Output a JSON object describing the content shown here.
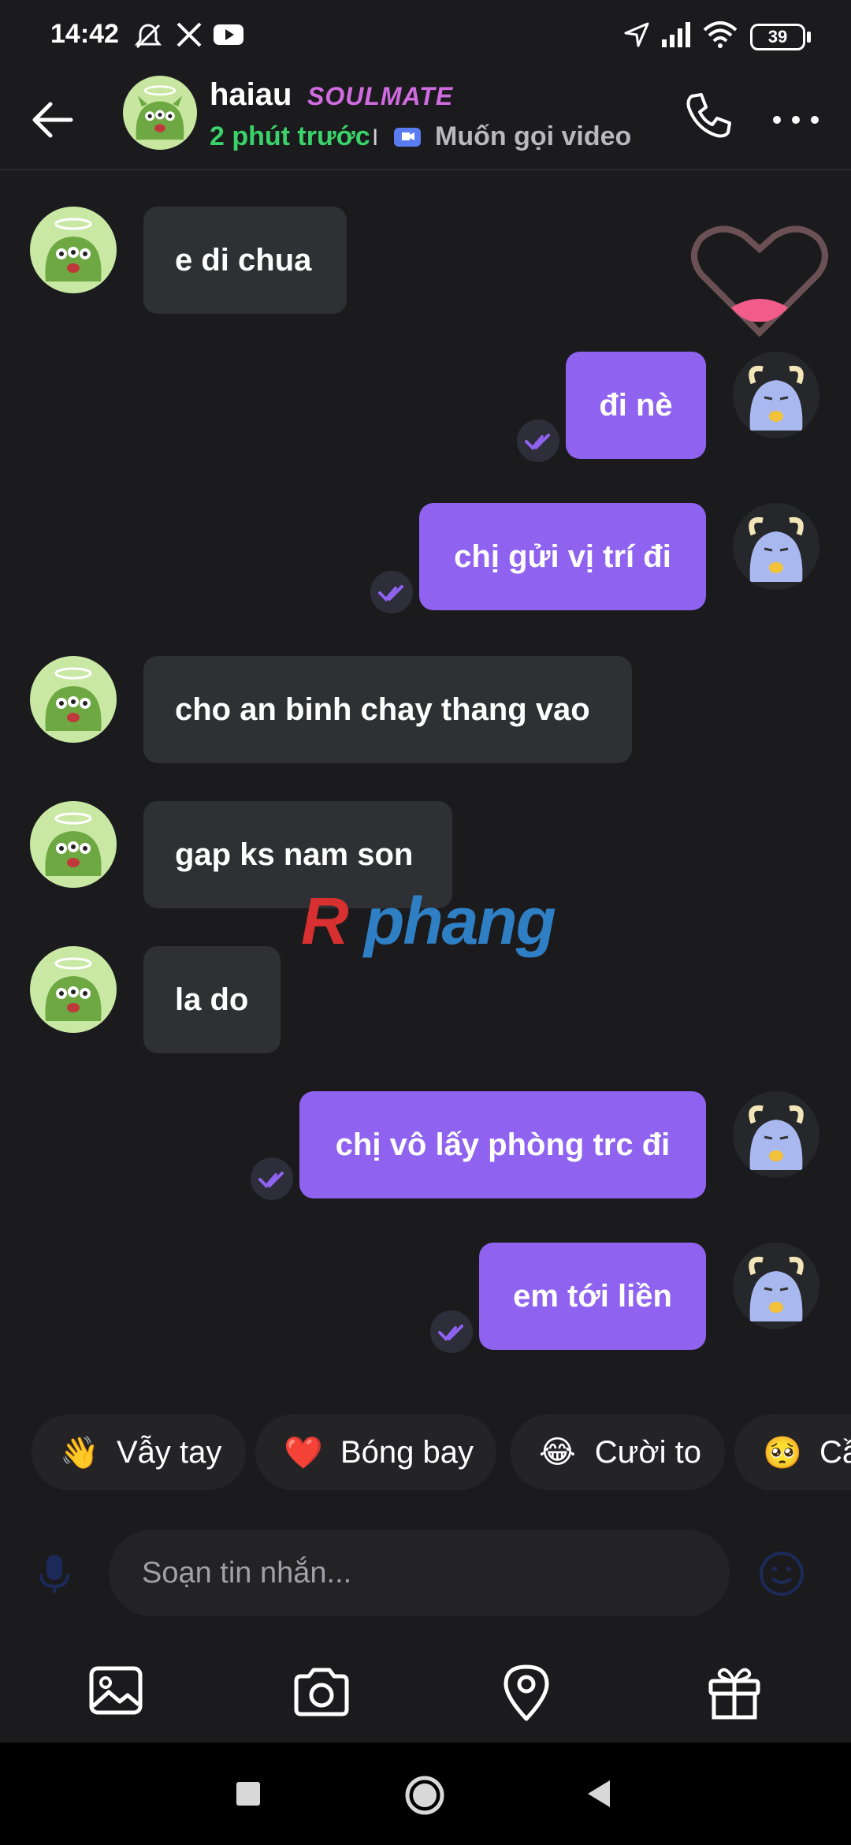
{
  "status_bar": {
    "time": "14:42",
    "battery": "39"
  },
  "header": {
    "name": "haiau",
    "badge": "SOULMATE",
    "last_seen": "2 phút trước",
    "separator": "I",
    "video_label": "Muốn gọi video"
  },
  "messages": [
    {
      "dir": "in",
      "text": "e di chua"
    },
    {
      "dir": "out",
      "text": "đi nè"
    },
    {
      "dir": "out",
      "text": "chị gửi vị trí đi"
    },
    {
      "dir": "in",
      "text": "cho an binh chay thang vao"
    },
    {
      "dir": "in",
      "text": "gap ks nam son"
    },
    {
      "dir": "in",
      "text": "la do"
    },
    {
      "dir": "out",
      "text": "chị vô lấy phòng trc đi"
    },
    {
      "dir": "out",
      "text": "em tới liền"
    }
  ],
  "watermark": "Rphang",
  "quick_replies": [
    {
      "emoji": "👋",
      "label": "Vẫy tay"
    },
    {
      "emoji": "❤️",
      "label": "Bóng bay"
    },
    {
      "emoji": "😂",
      "label": "Cười to"
    },
    {
      "emoji": "🥺",
      "label": "Cầ"
    }
  ],
  "input": {
    "placeholder": "Soạn tin nhắn..."
  },
  "colors": {
    "accent": "#8f63f0",
    "online": "#3ad36a",
    "incoming_bubble": "#2f3034",
    "background": "#1b1b1d"
  }
}
